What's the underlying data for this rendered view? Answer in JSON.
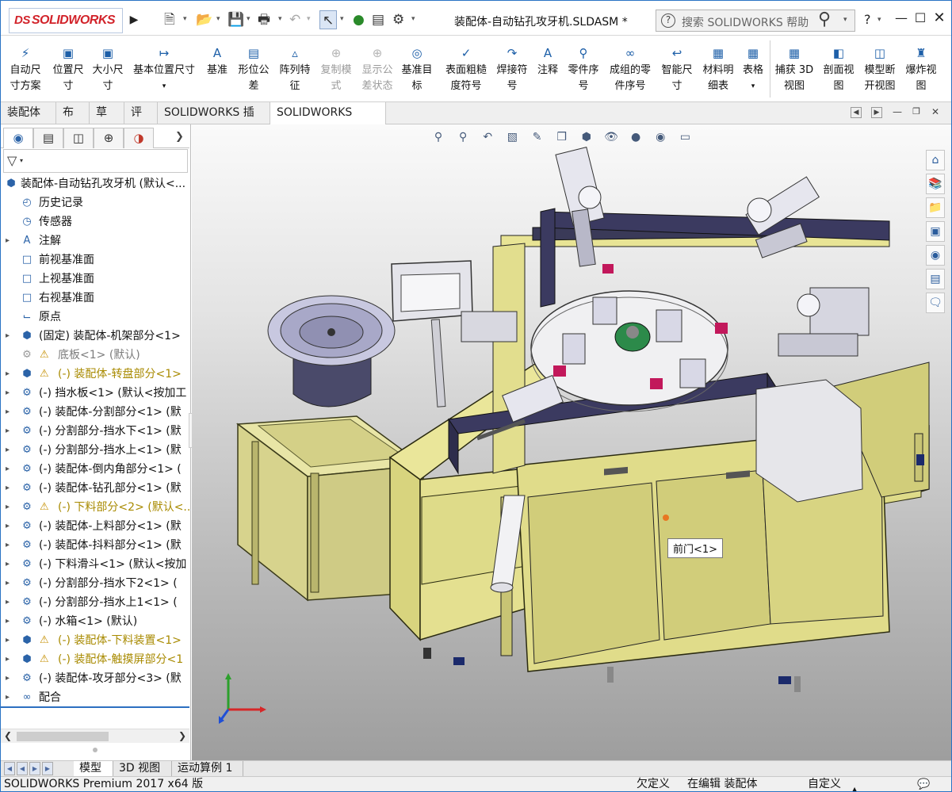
{
  "app": {
    "logo_text": "SOLIDWORKS",
    "document_title": "装配体-自动钻孔攻牙机.SLDASM *"
  },
  "help_search": {
    "placeholder": "搜索 SOLIDWORKS 帮助"
  },
  "command_manager": {
    "items": [
      {
        "label": "自动尺\n寸方案",
        "icon": "auto-dimension-icon",
        "enabled": true
      },
      {
        "label": "位置尺\n寸",
        "icon": "location-dimension-icon",
        "enabled": true
      },
      {
        "label": "大小尺\n寸",
        "icon": "size-dimension-icon",
        "enabled": true
      },
      {
        "label": "基本位置尺寸",
        "icon": "basic-location-dimension-icon",
        "enabled": true
      },
      {
        "label": "基准",
        "icon": "datum-icon",
        "enabled": true
      },
      {
        "label": "形位公\n差",
        "icon": "geometric-tolerance-icon",
        "enabled": true
      },
      {
        "label": "阵列特\n征",
        "icon": "pattern-feature-icon",
        "enabled": true
      },
      {
        "label": "复制模\n式",
        "icon": "copy-scheme-icon",
        "enabled": false
      },
      {
        "label": "显示公\n差状态",
        "icon": "show-tolerance-status-icon",
        "enabled": false
      },
      {
        "label": "基准目\n标",
        "icon": "datum-target-icon",
        "enabled": true
      },
      {
        "label": "表面粗糙\n度符号",
        "icon": "surface-finish-icon",
        "enabled": true
      },
      {
        "label": "焊接符\n号",
        "icon": "weld-symbol-icon",
        "enabled": true
      },
      {
        "label": "注释",
        "icon": "note-icon",
        "enabled": true
      },
      {
        "label": "零件序\n号",
        "icon": "balloon-icon",
        "enabled": true
      },
      {
        "label": "成组的零\n件序号",
        "icon": "stacked-balloon-icon",
        "enabled": true
      },
      {
        "label": "智能尺\n寸",
        "icon": "smart-dimension-icon",
        "enabled": true
      },
      {
        "label": "材料明\n细表",
        "icon": "bom-icon",
        "enabled": true
      },
      {
        "label": "表格",
        "icon": "table-icon",
        "enabled": true
      },
      {
        "label": "捕获 3D\n视图",
        "icon": "capture-3d-view-icon",
        "enabled": true
      },
      {
        "label": "剖面视\n图",
        "icon": "section-view-icon",
        "enabled": true
      },
      {
        "label": "模型断\n开视图",
        "icon": "model-break-view-icon",
        "enabled": true
      },
      {
        "label": "爆炸视\n图",
        "icon": "exploded-view-icon",
        "enabled": true
      }
    ]
  },
  "command_tabs": [
    {
      "label": "装配体",
      "active": false
    },
    {
      "label": "布局",
      "active": false
    },
    {
      "label": "草图",
      "active": false
    },
    {
      "label": "评估",
      "active": false
    },
    {
      "label": "SOLIDWORKS 插件",
      "active": false
    },
    {
      "label": "SOLIDWORKS MBD",
      "active": true
    }
  ],
  "feature_tree": {
    "root": "装配体-自动钻孔攻牙机 (默认<...",
    "items": [
      {
        "label": "历史记录",
        "icon": "history-icon",
        "style": "normal",
        "expander": false
      },
      {
        "label": "传感器",
        "icon": "sensor-icon",
        "style": "normal",
        "expander": false
      },
      {
        "label": "注解",
        "icon": "annotations-icon",
        "style": "normal",
        "expander": true
      },
      {
        "label": "前视基准面",
        "icon": "plane-icon",
        "style": "normal",
        "expander": false
      },
      {
        "label": "上视基准面",
        "icon": "plane-icon",
        "style": "normal",
        "expander": false
      },
      {
        "label": "右视基准面",
        "icon": "plane-icon",
        "style": "normal",
        "expander": false
      },
      {
        "label": "原点",
        "icon": "origin-icon",
        "style": "normal",
        "expander": false
      },
      {
        "label": "(固定) 装配体-机架部分<1>",
        "icon": "assembly-icon",
        "style": "normal",
        "expander": true
      },
      {
        "label": "底板<1> (默认)",
        "icon": "part-icon",
        "style": "warn-gray",
        "expander": false
      },
      {
        "label": "(-) 装配体-转盘部分<1>",
        "icon": "assembly-icon",
        "style": "warn",
        "expander": true
      },
      {
        "label": "(-) 挡水板<1> (默认<按加工",
        "icon": "part-icon",
        "style": "normal",
        "expander": true
      },
      {
        "label": "(-) 装配体-分割部分<1> (默",
        "icon": "part-icon",
        "style": "normal",
        "expander": true
      },
      {
        "label": "(-) 分割部分-挡水下<1> (默",
        "icon": "part-icon",
        "style": "normal",
        "expander": true
      },
      {
        "label": "(-) 分割部分-挡水上<1> (默",
        "icon": "part-icon",
        "style": "normal",
        "expander": true
      },
      {
        "label": "(-) 装配体-倒内角部分<1> (",
        "icon": "part-icon",
        "style": "normal",
        "expander": true
      },
      {
        "label": "(-) 装配体-钻孔部分<1> (默",
        "icon": "part-icon",
        "style": "normal",
        "expander": true
      },
      {
        "label": "(-) 下料部分<2> (默认<...",
        "icon": "part-icon",
        "style": "warn",
        "expander": true
      },
      {
        "label": "(-) 装配体-上料部分<1> (默",
        "icon": "part-icon",
        "style": "normal",
        "expander": true
      },
      {
        "label": "(-) 装配体-抖料部分<1> (默",
        "icon": "part-icon",
        "style": "normal",
        "expander": true
      },
      {
        "label": "(-) 下料滑斗<1> (默认<按加",
        "icon": "part-icon",
        "style": "normal",
        "expander": true
      },
      {
        "label": "(-) 分割部分-挡水下2<1> (",
        "icon": "part-icon",
        "style": "normal",
        "expander": true
      },
      {
        "label": "(-) 分割部分-挡水上1<1> (",
        "icon": "part-icon",
        "style": "normal",
        "expander": true
      },
      {
        "label": "(-) 水箱<1> (默认)",
        "icon": "part-icon",
        "style": "normal",
        "expander": true
      },
      {
        "label": "(-) 装配体-下料装置<1>",
        "icon": "assembly-icon",
        "style": "warn",
        "expander": true
      },
      {
        "label": "(-) 装配体-触摸屏部分<1",
        "icon": "assembly-icon",
        "style": "warn",
        "expander": true
      },
      {
        "label": "(-) 装配体-攻牙部分<3> (默",
        "icon": "part-icon",
        "style": "normal",
        "expander": true
      },
      {
        "label": "配合",
        "icon": "mates-icon",
        "style": "normal",
        "expander": true
      }
    ]
  },
  "viewport": {
    "tooltip": "前门<1>"
  },
  "bottom_tabs": [
    {
      "label": "模型",
      "active": true
    },
    {
      "label": "3D 视图",
      "active": false
    },
    {
      "label": "运动算例 1",
      "active": false
    }
  ],
  "status_bar": {
    "version": "SOLIDWORKS Premium 2017 x64 版",
    "definition": "欠定义",
    "editing": "在编辑 装配体",
    "units": "自定义"
  },
  "colors": {
    "accent": "#2c6fc1",
    "warning_text": "#a88a00",
    "logo_red": "#d2232a"
  }
}
